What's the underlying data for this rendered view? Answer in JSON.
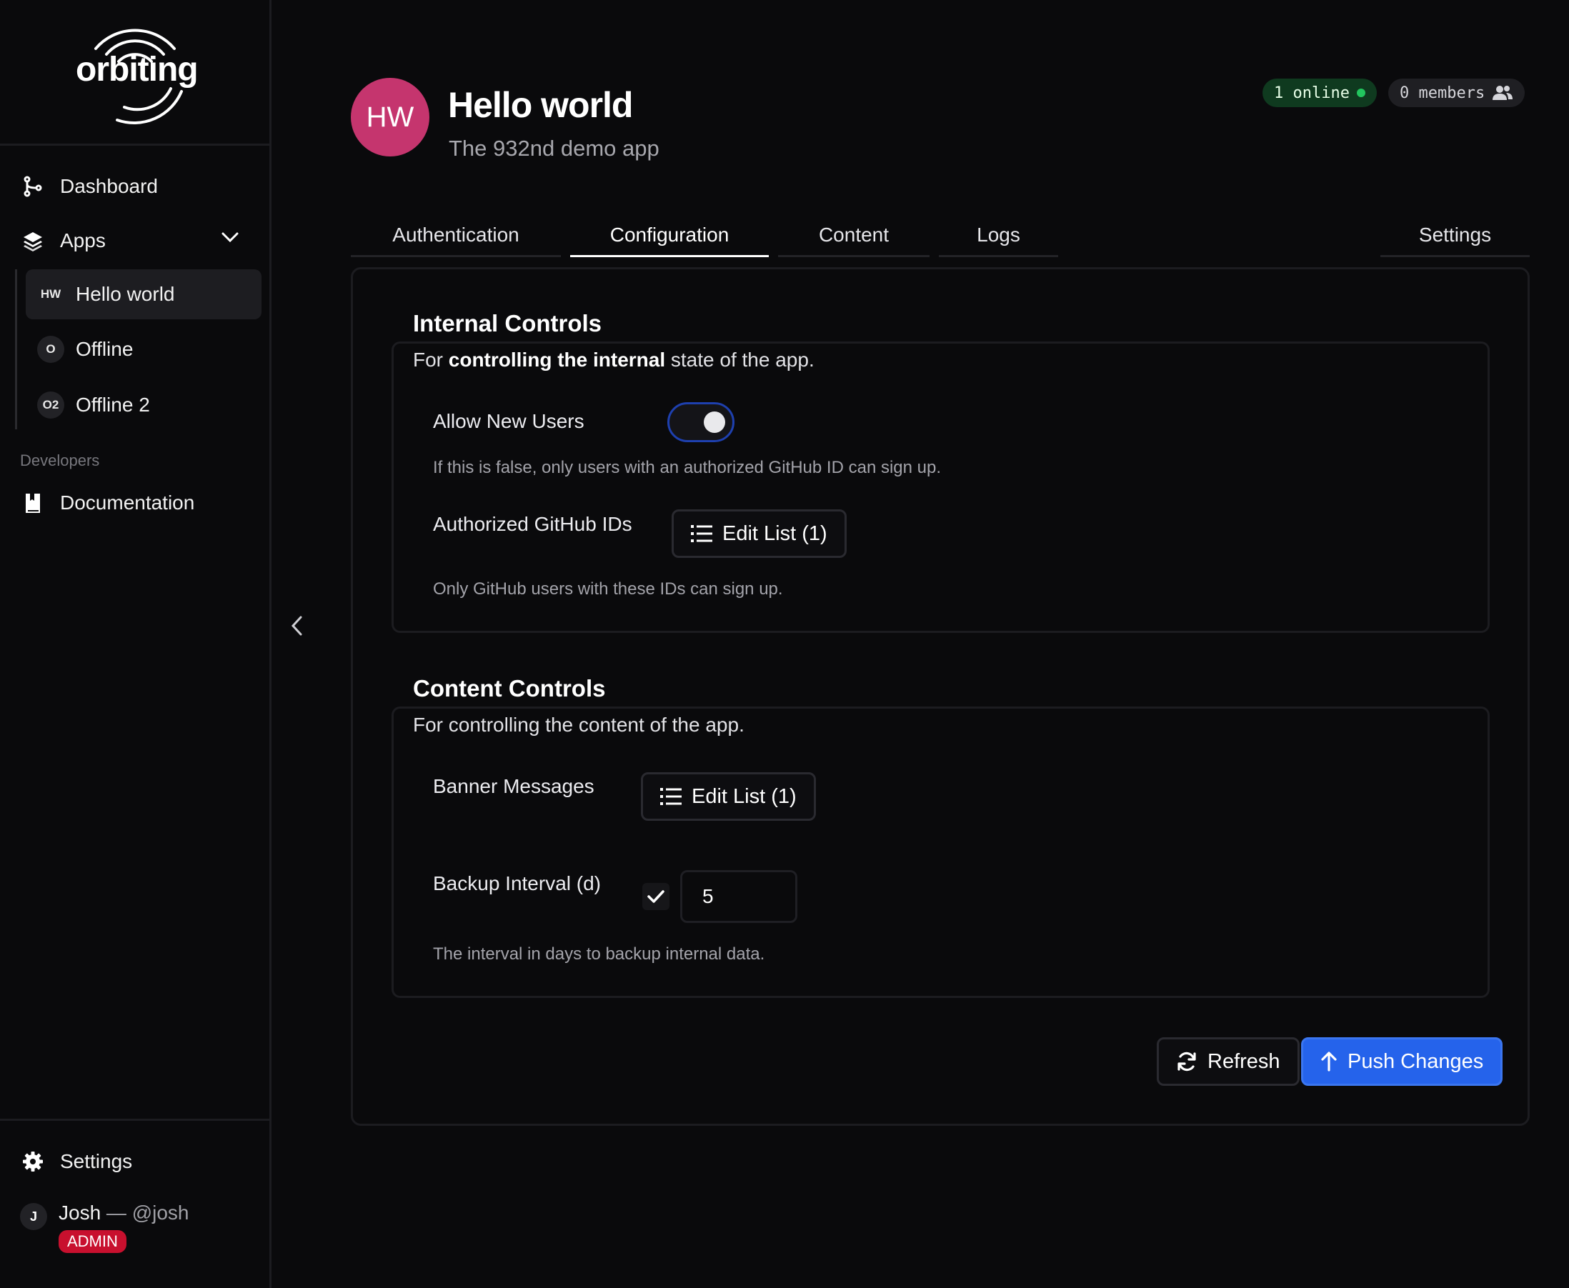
{
  "sidebar": {
    "logo_text": "orbiting",
    "nav": {
      "dashboard": "Dashboard",
      "apps": "Apps"
    },
    "apps": [
      {
        "badge": "HW",
        "name": "Hello world",
        "active": true
      },
      {
        "badge": "O",
        "name": "Offline",
        "active": false
      },
      {
        "badge": "O2",
        "name": "Offline 2",
        "active": false
      }
    ],
    "section_developers": "Developers",
    "documentation": "Documentation",
    "settings": "Settings",
    "user": {
      "initial": "J",
      "name": "Josh",
      "separator": " — ",
      "handle": "@josh",
      "role": "ADMIN"
    }
  },
  "header": {
    "avatar_initials": "HW",
    "title": "Hello world",
    "subtitle": "The 932nd demo app",
    "online_label": "1 online",
    "members_label": "0 members"
  },
  "tabs": [
    {
      "label": "Authentication",
      "active": false
    },
    {
      "label": "Configuration",
      "active": true
    },
    {
      "label": "Content",
      "active": false
    },
    {
      "label": "Logs",
      "active": false
    },
    {
      "label": "Settings",
      "active": false
    }
  ],
  "internal": {
    "title": "Internal Controls",
    "desc_prefix": "For ",
    "desc_bold": "controlling the internal",
    "desc_suffix": " state of the app.",
    "allow_new_users_label": "Allow New Users",
    "allow_new_users_value": true,
    "allow_new_users_help": "If this is false, only users with an authorized GitHub ID can sign up.",
    "github_ids_label": "Authorized GitHub IDs",
    "github_ids_button": "Edit List (1)",
    "github_ids_help": "Only GitHub users with these IDs can sign up."
  },
  "content": {
    "title": "Content Controls",
    "desc": "For controlling the content of the app.",
    "banner_label": "Banner Messages",
    "banner_button": "Edit List (1)",
    "backup_label": "Backup Interval (d)",
    "backup_enabled": true,
    "backup_value": "5",
    "backup_help": "The interval in days to backup internal data."
  },
  "actions": {
    "refresh": "Refresh",
    "push": "Push Changes"
  },
  "colors": {
    "accent": "#2563eb",
    "avatar": "#c5356e",
    "online": "#22c55e",
    "admin": "#c8102e"
  }
}
